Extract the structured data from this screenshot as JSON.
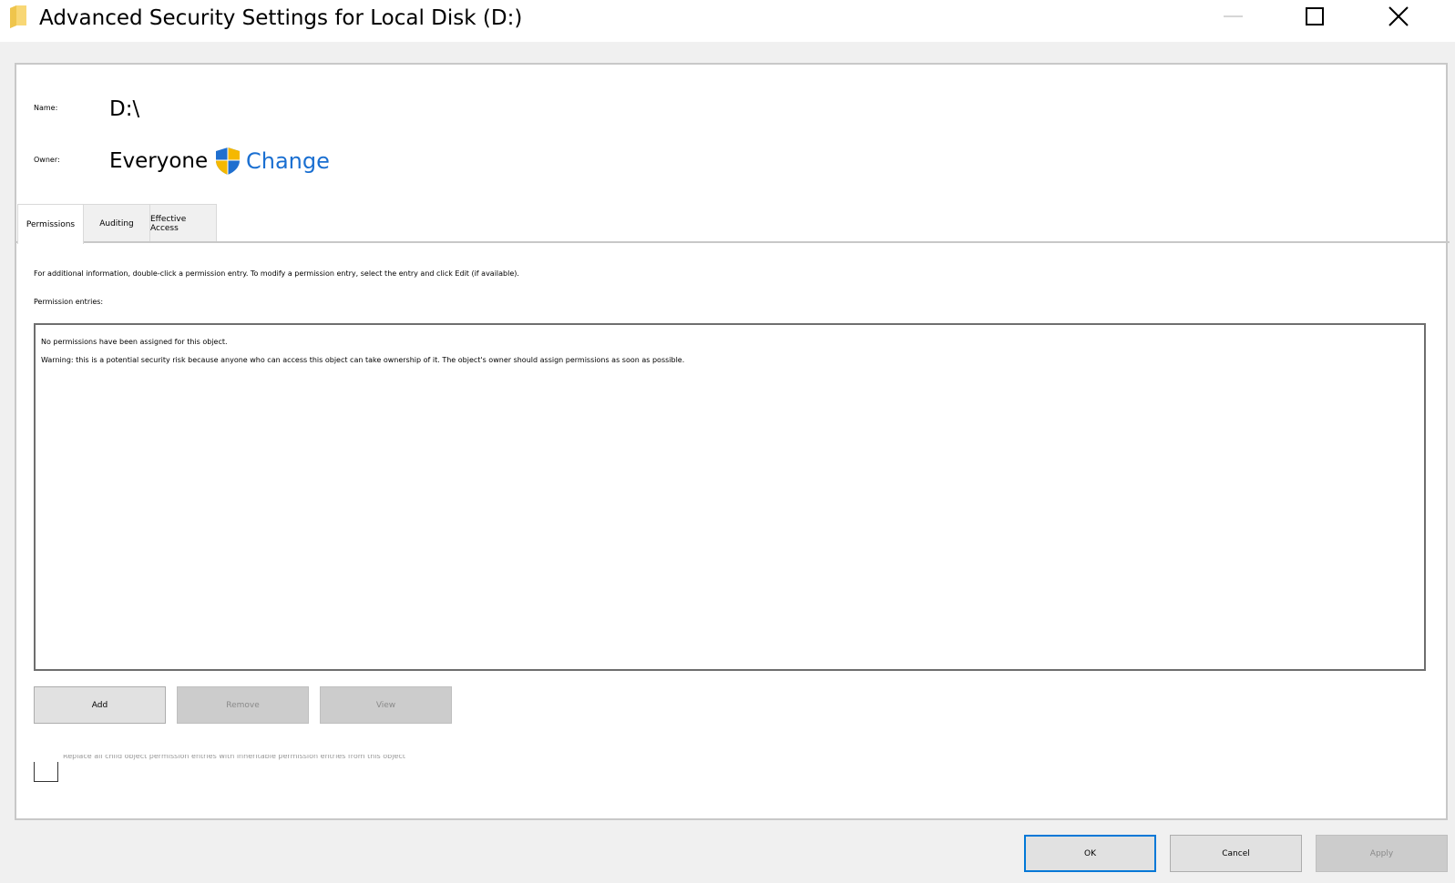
{
  "window": {
    "title": "Advanced Security Settings for Local Disk (D:)",
    "icon": "folder-icon",
    "controls": [
      "minimize-icon",
      "maximize-icon",
      "close-icon"
    ]
  },
  "object": {
    "name_label": "Name:",
    "name_value": "D:\\",
    "owner_label": "Owner:",
    "owner_value": "Everyone",
    "change_label": "Change"
  },
  "tabs": [
    {
      "label": "Permissions",
      "active": true
    },
    {
      "label": "Auditing",
      "active": false
    },
    {
      "label": "Effective Access",
      "active": false
    }
  ],
  "permissions": {
    "instructions": "For additional information, double-click a permission entry. To modify a permission entry, select the entry and click Edit (if available).",
    "entries_label": "Permission entries:",
    "empty_message": "No permissions have been assigned for this object.",
    "warning_message": "Warning: this is a potential security risk because anyone who can access this object can take ownership of it. The object's owner should assign permissions as soon as possible.",
    "buttons": {
      "add": "Add",
      "remove": "Remove",
      "view": "View"
    },
    "replace_checkbox_label": "Replace all child object permission entries with inheritable permission entries from this object",
    "replace_checked": false
  },
  "dialog_buttons": {
    "ok": "OK",
    "cancel": "Cancel",
    "apply": "Apply"
  },
  "colors": {
    "link": "#1a6fd1",
    "default_button_border": "#0078d7",
    "folder": "#f8d775",
    "shield_blue": "#1f6fcf",
    "shield_yellow": "#f5b800"
  }
}
